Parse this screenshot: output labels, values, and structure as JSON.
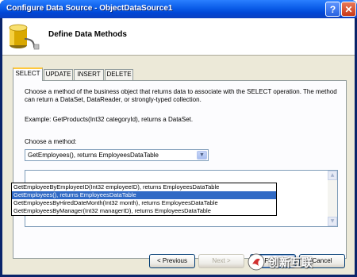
{
  "window": {
    "title": "Configure Data Source - ObjectDataSource1",
    "help_glyph": "?",
    "close_glyph": "✕"
  },
  "header": {
    "title": "Define Data Methods",
    "icon": "database-icon"
  },
  "tabs": [
    {
      "label": "SELECT",
      "active": true
    },
    {
      "label": "UPDATE",
      "active": false
    },
    {
      "label": "INSERT",
      "active": false
    },
    {
      "label": "DELETE",
      "active": false
    }
  ],
  "panel": {
    "description": "Choose a method of the business object that returns data to associate with the SELECT operation. The method can return a DataSet, DataReader, or strongly-typed collection.",
    "example": "Example: GetProducts(Int32 categoryId), returns a DataSet.",
    "choose_label": "Choose a method:",
    "selected_method": "GetEmployees(), returns EmployeesDataTable",
    "options": [
      "GetEmployeeByEmployeeID(Int32 employeeID), returns EmployeesDataTable",
      "GetEmployees(), returns EmployeesDataTable",
      "GetEmployeesByHiredDateMonth(Int32 month), returns EmployeesDataTable",
      "GetEmployeesByManager(Int32 managerID), returns EmployeesDataTable"
    ],
    "highlighted_option_index": 1
  },
  "buttons": {
    "previous": "< Previous",
    "next": "Next >",
    "finish": "Finish",
    "cancel": "Cancel"
  },
  "watermark": {
    "text": "创新互联"
  },
  "colors": {
    "titlebar": "#0a5ce8",
    "selection": "#316ac5",
    "dialog_bg": "#ece9d8",
    "active_tab_accent": "#ffc83c"
  }
}
